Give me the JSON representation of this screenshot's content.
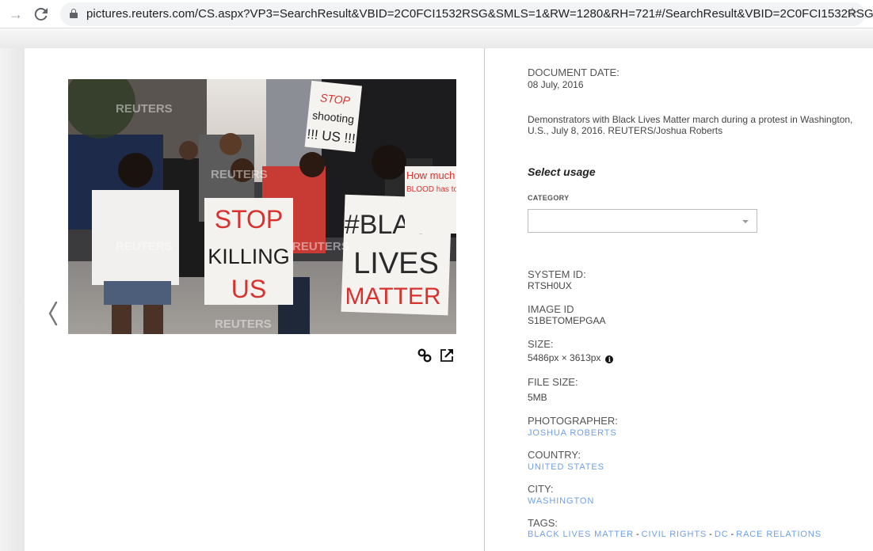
{
  "browser": {
    "url": "pictures.reuters.com/CS.aspx?VP3=SearchResult&VBID=2C0FCI1532RSG&SMLS=1&RW=1280&RH=721#/SearchResult&VBID=2C0FCI1532RSG...",
    "forward_icon": "→",
    "reload_icon": "⟳",
    "bookmark_icon": "☆"
  },
  "viewer": {
    "prev_icon": "chevron-left",
    "photo_alt": "Demonstrators with Black Lives Matter march during a protest in Washington",
    "watermark": "REUTERS",
    "signs": {
      "stop_killing": [
        "STOP",
        "KILLING",
        "US"
      ],
      "black_lives": [
        "#BLACK",
        "LIVES",
        "MATTER"
      ],
      "stop_shooting": [
        "STOP",
        "shooting",
        "!!! US !!!"
      ],
      "how_much": [
        "How much",
        "BLOOD has to"
      ]
    },
    "actions": {
      "link_icon": "link",
      "open_icon": "external-link"
    }
  },
  "details": {
    "document_date_label": "DOCUMENT DATE:",
    "document_date": "08 July, 2016",
    "caption": "Demonstrators with Black Lives Matter march during a protest in Washington, U.S., July 8, 2016. REUTERS/Joshua Roberts",
    "usage_title": "Select usage",
    "category_label": "CATEGORY",
    "category_value": "",
    "system_id_label": "SYSTEM ID:",
    "system_id": "RTSH0UX",
    "image_id_label": "IMAGE ID",
    "image_id": "S1BETOMEPGAA",
    "size_label": "SIZE:",
    "size": "5486px × 3613px",
    "info_glyph": "i",
    "file_size_label": "FILE SIZE:",
    "file_size": "5MB",
    "photographer_label": "PHOTOGRAPHER:",
    "photographer": "JOSHUA ROBERTS",
    "country_label": "COUNTRY:",
    "country": "UNITED STATES",
    "city_label": "CITY:",
    "city": "WASHINGTON",
    "tags_label": "TAGS:",
    "tags": [
      "BLACK LIVES MATTER",
      "CIVIL RIGHTS",
      "DC",
      "RACE RELATIONS"
    ],
    "tag_separator": "-"
  },
  "colors": {
    "link": "#6fa0e6",
    "label": "#555555",
    "divider": "#c4c4c4"
  }
}
